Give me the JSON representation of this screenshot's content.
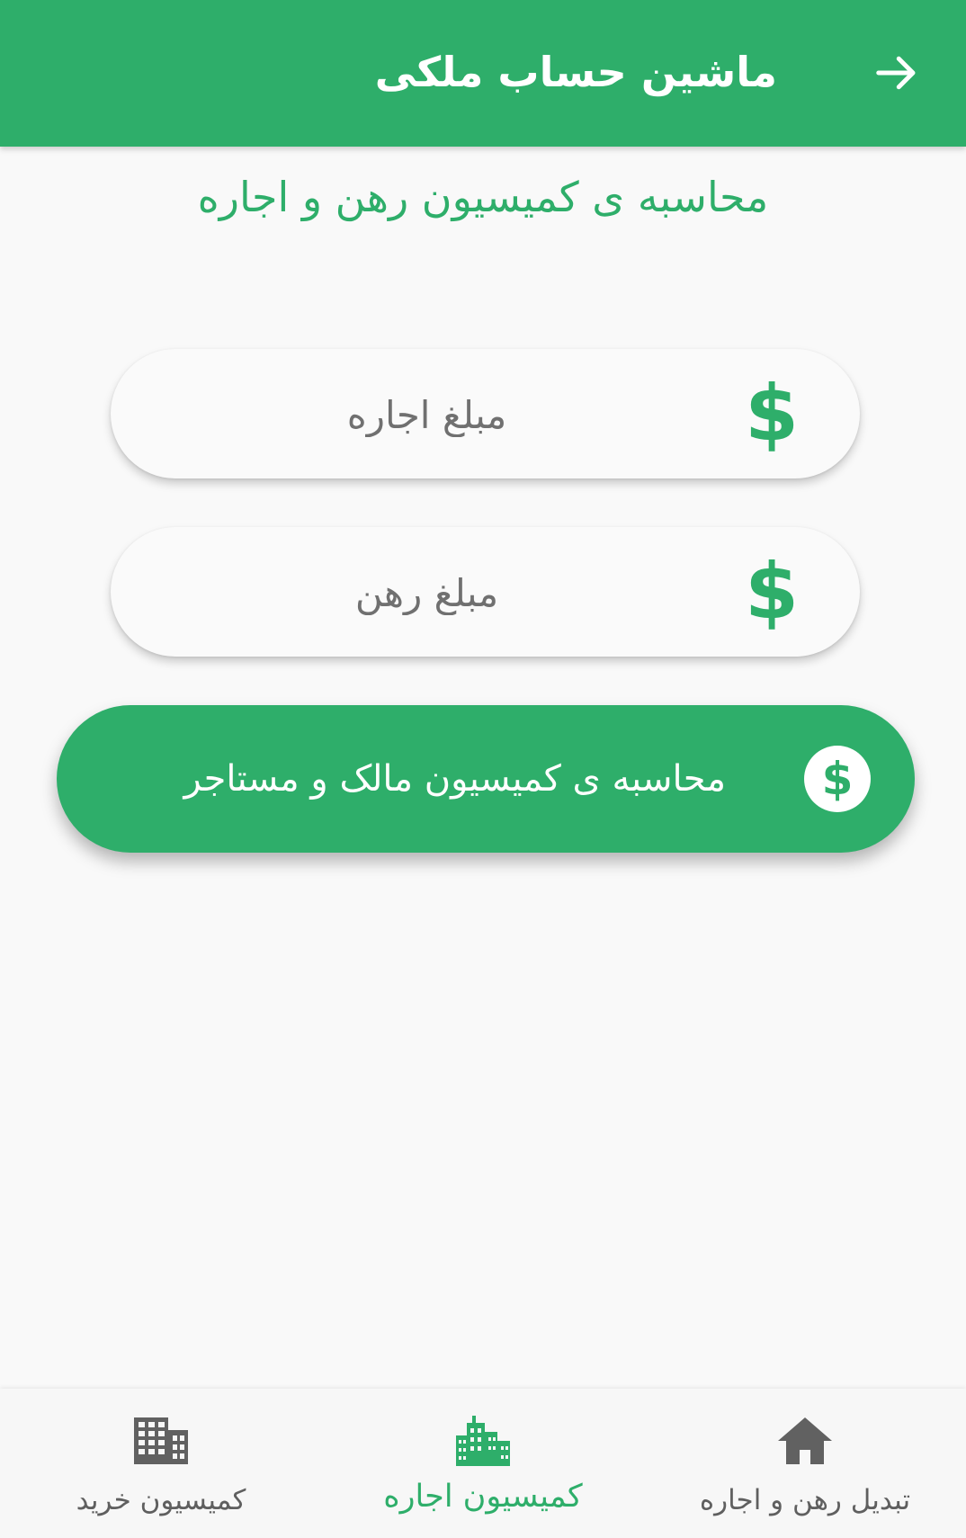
{
  "appbar": {
    "title": "ماشین حساب ملکی",
    "back_icon": "arrow-right-icon"
  },
  "page": {
    "subtitle": "محاسبه ی کمیسیون رهن و اجاره"
  },
  "form": {
    "rent_amount": {
      "placeholder": "مبلغ اجاره",
      "value": "",
      "icon": "dollar-icon"
    },
    "deposit_amount": {
      "placeholder": "مبلغ رهن",
      "value": "",
      "icon": "dollar-icon"
    },
    "calculate_button": {
      "label": "محاسبه ی کمیسیون مالک و مستاجر",
      "icon": "dollar-circle-icon"
    }
  },
  "bottom_nav": {
    "items": [
      {
        "label": "کمیسیون خرید",
        "icon": "building-grid-icon",
        "active": false
      },
      {
        "label": "کمیسیون اجاره",
        "icon": "city-buildings-icon",
        "active": true
      },
      {
        "label": "تبدیل رهن و اجاره",
        "icon": "home-icon",
        "active": false
      }
    ]
  },
  "colors": {
    "primary": "#2eae6a",
    "background": "#f9f9f9",
    "inactive_nav": "#5f5f5f"
  }
}
